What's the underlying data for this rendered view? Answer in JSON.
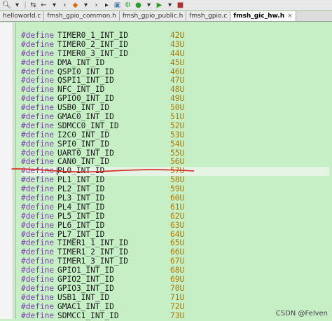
{
  "toolbar": {
    "icons": [
      "search-icon",
      "dropdown-icon",
      "back-forward-icon",
      "back-icon",
      "forward-icon",
      "bookmark-icon",
      "back-icon",
      "forward-icon",
      "dropdown-icon",
      "run-icon",
      "step-icon",
      "dropdown-icon",
      "stop-icon"
    ]
  },
  "tabs": [
    {
      "label": "helloworld.c",
      "active": false
    },
    {
      "label": "fmsh_gpio_common.h",
      "active": false
    },
    {
      "label": "fmsh_gpio_public.h",
      "active": false
    },
    {
      "label": "fmsh_gpio.c",
      "active": false
    },
    {
      "label": "fmsh_gic_hw.h",
      "active": true,
      "close": "×"
    }
  ],
  "editor": {
    "directive": "#define",
    "lines": [
      {
        "name": "TIMER0_1_INT_ID",
        "value": "42U"
      },
      {
        "name": "TIMER0_2_INT_ID",
        "value": "43U"
      },
      {
        "name": "TIMER0_3_INT_ID",
        "value": "44U"
      },
      {
        "name": "DMA_INT_ID",
        "value": "45U"
      },
      {
        "name": "QSPI0_INT_ID",
        "value": "46U"
      },
      {
        "name": "QSPI1_INT_ID",
        "value": "47U"
      },
      {
        "name": "NFC_INT_ID",
        "value": "48U"
      },
      {
        "name": "GPIO0_INT_ID",
        "value": "49U"
      },
      {
        "name": "USB0_INT_ID",
        "value": "50U"
      },
      {
        "name": "GMAC0_INT_ID",
        "value": "51U"
      },
      {
        "name": "SDMCC0_INT_ID",
        "value": "52U"
      },
      {
        "name": "I2C0_INT_ID",
        "value": "53U"
      },
      {
        "name": "SPI0_INT_ID",
        "value": "54U"
      },
      {
        "name": "UART0_INT_ID",
        "value": "55U"
      },
      {
        "name": "CAN0_INT_ID",
        "value": "56U"
      },
      {
        "name": "PL0_INT_ID",
        "value": "57U",
        "current": true
      },
      {
        "name": "PL1_INT_ID",
        "value": "58U"
      },
      {
        "name": "PL2_INT_ID",
        "value": "59U"
      },
      {
        "name": "PL3_INT_ID",
        "value": "60U"
      },
      {
        "name": "PL4_INT_ID",
        "value": "61U"
      },
      {
        "name": "PL5_INT_ID",
        "value": "62U"
      },
      {
        "name": "PL6_INT_ID",
        "value": "63U"
      },
      {
        "name": "PL7_INT_ID",
        "value": "64U"
      },
      {
        "name": "TIMER1_1_INT_ID",
        "value": "65U"
      },
      {
        "name": "TIMER1_2_INT_ID",
        "value": "66U"
      },
      {
        "name": "TIMER1_3_INT_ID",
        "value": "67U"
      },
      {
        "name": "GPIO1_INT_ID",
        "value": "68U"
      },
      {
        "name": "GPIO2_INT_ID",
        "value": "69U"
      },
      {
        "name": "GPIO3_INT_ID",
        "value": "70U"
      },
      {
        "name": "USB1_INT_ID",
        "value": "71U"
      },
      {
        "name": "GMAC1_INT_ID",
        "value": "72U"
      },
      {
        "name": "SDMCC1_INT_ID",
        "value": "73U"
      }
    ]
  },
  "annotation": {
    "color": "#d8271f"
  },
  "watermark": "CSDN @Felven",
  "colors": {
    "editor_background": "#c6efc6",
    "keyword": "#7a3fb0",
    "number": "#b07800"
  }
}
